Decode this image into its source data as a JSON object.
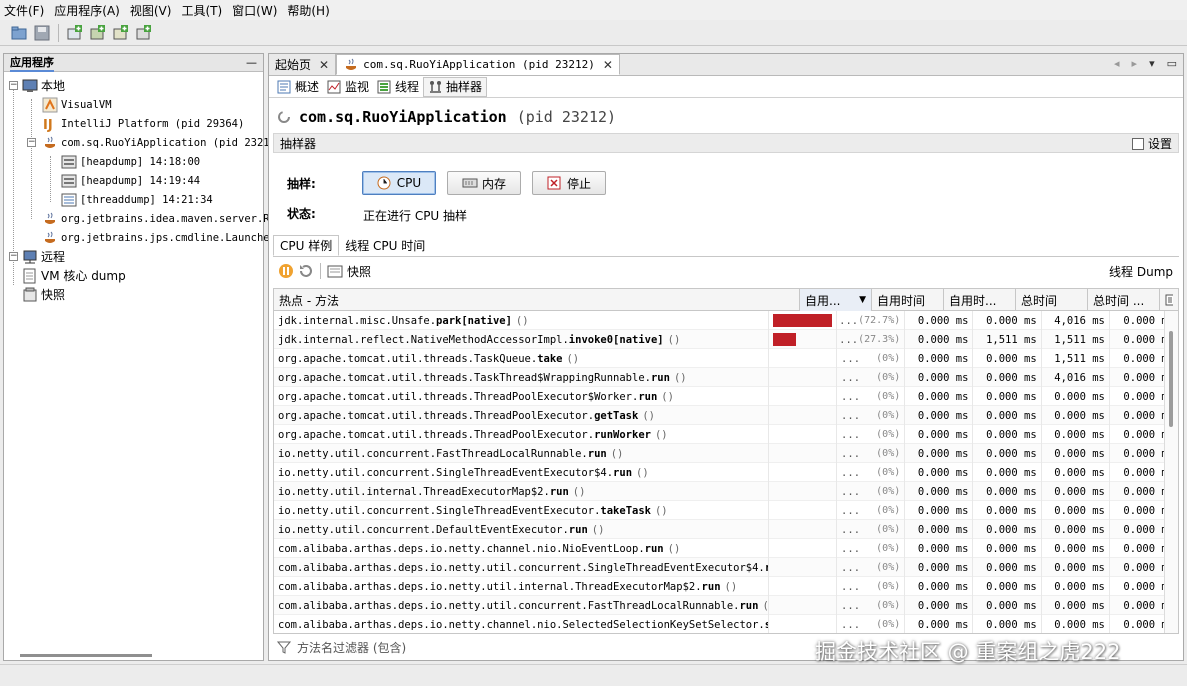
{
  "menu": [
    "文件(F)",
    "应用程序(A)",
    "视图(V)",
    "工具(T)",
    "窗口(W)",
    "帮助(H)"
  ],
  "toolbar": {
    "icons": [
      "open-file-icon",
      "save-icon",
      "add-jmx-icon",
      "add-remote-icon",
      "add-coredump-icon",
      "add-snapshot-icon"
    ]
  },
  "left_panel": {
    "title": "应用程序",
    "minimize": "—",
    "tree": {
      "local": "本地",
      "visualvm": "VisualVM",
      "intellij": "IntelliJ Platform (pid 29364)",
      "ruoyi": "com.sq.RuoYiApplication (pid 23212",
      "heapdump1": "[heapdump] 14:18:00",
      "heapdump2": "[heapdump] 14:19:44",
      "threaddump": "[threaddump] 14:21:34",
      "maven": "org.jetbrains.idea.maven.server.Re",
      "jps": "org.jetbrains.jps.cmdline.Launcher",
      "remote": "远程",
      "vm_core": "VM 核心 dump",
      "snapshots": "快照"
    }
  },
  "doc_tabs": {
    "start": "起始页",
    "app": "com.sq.RuoYiApplication (pid 23212)",
    "close": "✕"
  },
  "sub_tabs": [
    "概述",
    "监视",
    "线程",
    "抽样器"
  ],
  "app_header": {
    "name": "com.sq.RuoYiApplication",
    "pid": "(pid 23212)"
  },
  "sampler": {
    "section": "抽样器",
    "settings": "设置",
    "sample_label": "抽样:",
    "status_label": "状态:",
    "status_text": "正在进行 CPU 抽样",
    "buttons": {
      "cpu": "CPU",
      "memory": "内存",
      "stop": "停止"
    }
  },
  "inner_tabs": [
    "CPU 样例",
    "线程 CPU 时间"
  ],
  "result_bar": {
    "snapshot": "快照",
    "thread_dump": "线程 Dump"
  },
  "table": {
    "headers": [
      "热点 - 方法",
      "自用...",
      "自用时间",
      "自用时...",
      "总时间",
      "总时间 ..."
    ],
    "rows": [
      {
        "pkg": "jdk.internal.misc.Unsafe.",
        "method": "park[native]",
        "bar": 0.727,
        "pct": "(72.7%)",
        "self_time": "0.000 ms",
        "total": "4,016 ms",
        "total_cpu": "0.000 ms"
      },
      {
        "pkg": "jdk.internal.reflect.NativeMethodAccessorImpl.",
        "method": "invoke0[native]",
        "bar": 0.273,
        "pct": "(27.3%)",
        "self_time": "0.000 ms",
        "total": "1,511 ms",
        "total_cpu": "0.000 ms",
        "self_wall": "1,511 ms"
      },
      {
        "pkg": "org.apache.tomcat.util.threads.TaskQueue.",
        "method": "take",
        "bar": 0,
        "pct": "(0%)",
        "self_time": "0.000 ms",
        "total": "1,511 ms",
        "total_cpu": "0.000 ms"
      },
      {
        "pkg": "org.apache.tomcat.util.threads.TaskThread$WrappingRunnable.",
        "method": "run",
        "bar": 0,
        "pct": "(0%)",
        "self_time": "0.000 ms",
        "total": "4,016 ms",
        "total_cpu": "0.000 ms"
      },
      {
        "pkg": "org.apache.tomcat.util.threads.ThreadPoolExecutor$Worker.",
        "method": "run",
        "bar": 0,
        "pct": "(0%)",
        "self_time": "0.000 ms",
        "total": "0.000 ms",
        "total_cpu": "0.000 ms"
      },
      {
        "pkg": "org.apache.tomcat.util.threads.ThreadPoolExecutor.",
        "method": "getTask",
        "bar": 0,
        "pct": "(0%)",
        "self_time": "0.000 ms",
        "total": "0.000 ms",
        "total_cpu": "0.000 ms"
      },
      {
        "pkg": "org.apache.tomcat.util.threads.ThreadPoolExecutor.",
        "method": "runWorker",
        "bar": 0,
        "pct": "(0%)",
        "self_time": "0.000 ms",
        "total": "0.000 ms",
        "total_cpu": "0.000 ms"
      },
      {
        "pkg": "io.netty.util.concurrent.FastThreadLocalRunnable.",
        "method": "run",
        "bar": 0,
        "pct": "(0%)",
        "self_time": "0.000 ms",
        "total": "0.000 ms",
        "total_cpu": "0.000 ms"
      },
      {
        "pkg": "io.netty.util.concurrent.SingleThreadEventExecutor$4.",
        "method": "run",
        "bar": 0,
        "pct": "(0%)",
        "self_time": "0.000 ms",
        "total": "0.000 ms",
        "total_cpu": "0.000 ms"
      },
      {
        "pkg": "io.netty.util.internal.ThreadExecutorMap$2.",
        "method": "run",
        "bar": 0,
        "pct": "(0%)",
        "self_time": "0.000 ms",
        "total": "0.000 ms",
        "total_cpu": "0.000 ms"
      },
      {
        "pkg": "io.netty.util.concurrent.SingleThreadEventExecutor.",
        "method": "takeTask",
        "bar": 0,
        "pct": "(0%)",
        "self_time": "0.000 ms",
        "total": "0.000 ms",
        "total_cpu": "0.000 ms"
      },
      {
        "pkg": "io.netty.util.concurrent.DefaultEventExecutor.",
        "method": "run",
        "bar": 0,
        "pct": "(0%)",
        "self_time": "0.000 ms",
        "total": "0.000 ms",
        "total_cpu": "0.000 ms"
      },
      {
        "pkg": "com.alibaba.arthas.deps.io.netty.channel.nio.NioEventLoop.",
        "method": "run",
        "bar": 0,
        "pct": "(0%)",
        "self_time": "0.000 ms",
        "total": "0.000 ms",
        "total_cpu": "0.000 ms"
      },
      {
        "pkg": "com.alibaba.arthas.deps.io.netty.util.concurrent.SingleThreadEventExecutor$4.",
        "method": "run",
        "bar": 0,
        "pct": "(0%)",
        "self_time": "0.000 ms",
        "total": "0.000 ms",
        "total_cpu": "0.000 ms"
      },
      {
        "pkg": "com.alibaba.arthas.deps.io.netty.util.internal.ThreadExecutorMap$2.",
        "method": "run",
        "bar": 0,
        "pct": "(0%)",
        "self_time": "0.000 ms",
        "total": "0.000 ms",
        "total_cpu": "0.000 ms"
      },
      {
        "pkg": "com.alibaba.arthas.deps.io.netty.util.concurrent.FastThreadLocalRunnable.",
        "method": "run",
        "bar": 0,
        "pct": "(0%)",
        "self_time": "0.000 ms",
        "total": "0.000 ms",
        "total_cpu": "0.000 ms"
      },
      {
        "pkg": "com.alibaba.arthas.deps.io.netty.channel.nio.SelectedSelectionKeySetSelector.",
        "method": "select",
        "bar": 0,
        "pct": "(0%)",
        "self_time": "0.000 ms",
        "total": "0.000 ms",
        "total_cpu": "0.000 ms",
        "truncated": true
      }
    ],
    "dots": "...",
    "paren": "()",
    "ellipsis_paren": "..."
  },
  "filter": {
    "placeholder": "方法名过滤器 (包含)"
  },
  "watermark": "掘金技术社区 @ 重案组之虎222",
  "colors": {
    "bar": "#c02027",
    "accent": "#4f7fbf"
  }
}
